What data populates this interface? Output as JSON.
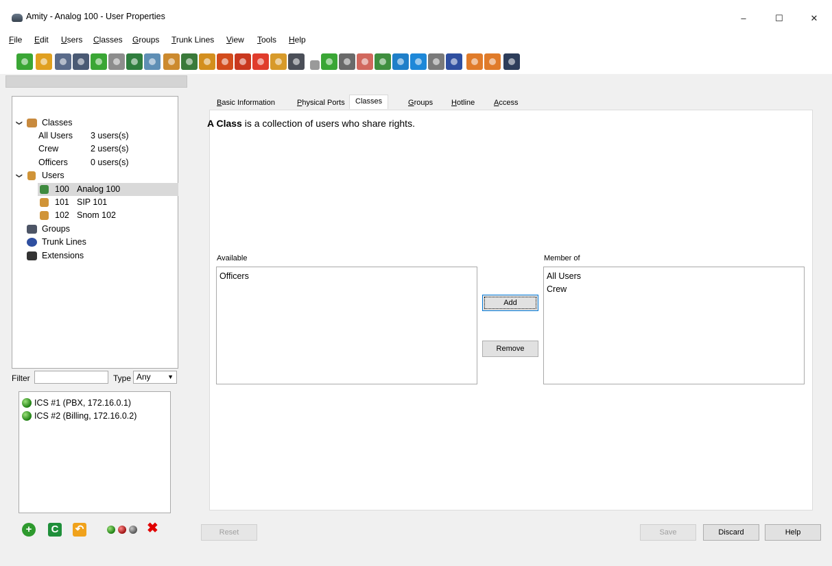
{
  "window": {
    "title": "Amity - Analog 100 - User Properties"
  },
  "menu": [
    {
      "label": "File",
      "u": "F",
      "rest": "ile"
    },
    {
      "label": "Edit",
      "u": "E",
      "rest": "dit"
    },
    {
      "label": "Users",
      "u": "U",
      "rest": "sers"
    },
    {
      "label": "Classes",
      "u": "C",
      "rest": "lasses"
    },
    {
      "label": "Groups",
      "u": "G",
      "rest": "roups"
    },
    {
      "label": "Trunk Lines",
      "u": "T",
      "rest": "runk Lines"
    },
    {
      "label": "View",
      "u": "V",
      "rest": "iew"
    },
    {
      "label": "Tools",
      "u": "T",
      "rest": "ools"
    },
    {
      "label": "Help",
      "u": "H",
      "rest": "elp"
    }
  ],
  "tree": {
    "classes_label": "Classes",
    "classes": [
      {
        "name": "All Users",
        "count": "3 users(s)"
      },
      {
        "name": "Crew",
        "count": "2 users(s)"
      },
      {
        "name": "Officers",
        "count": "0 users(s)"
      }
    ],
    "users_label": "Users",
    "users": [
      {
        "ext": "100",
        "name": "Analog 100",
        "selected": true
      },
      {
        "ext": "101",
        "name": "SIP 101",
        "selected": false
      },
      {
        "ext": "102",
        "name": "Snom 102",
        "selected": false
      }
    ],
    "groups_label": "Groups",
    "trunk_lines_label": "Trunk Lines",
    "extensions_label": "Extensions"
  },
  "filter": {
    "label": "Filter",
    "value": "",
    "type_label": "Type",
    "type_value": "Any"
  },
  "servers": [
    {
      "label": "ICS #1 (PBX, 172.16.0.1)",
      "status": "green"
    },
    {
      "label": "ICS #2 (Billing, 172.16.0.2)",
      "status": "green"
    }
  ],
  "tabs": [
    {
      "label": "Basic Information",
      "active": false
    },
    {
      "label": "Physical Ports",
      "active": false
    },
    {
      "label": "Classes",
      "active": true
    },
    {
      "label": "Groups",
      "active": false
    },
    {
      "label": "Hotline",
      "active": false
    },
    {
      "label": "Access",
      "active": false
    }
  ],
  "classes_tab": {
    "desc_bold": "A Class",
    "desc_rest": " is a collection of users who share rights.",
    "available_label": "Available",
    "available": [
      "Officers"
    ],
    "member_label": "Member of",
    "member": [
      "All Users",
      "Crew"
    ],
    "add_label": "Add",
    "remove_label": "Remove"
  },
  "buttons": {
    "reset": "Reset",
    "save": "Save",
    "discard": "Discard",
    "help": "Help"
  },
  "colors": {
    "selection": "#d9d9d9",
    "panel": "#ffffff",
    "background": "#f0f0f0",
    "delete_red": "#e00000"
  }
}
